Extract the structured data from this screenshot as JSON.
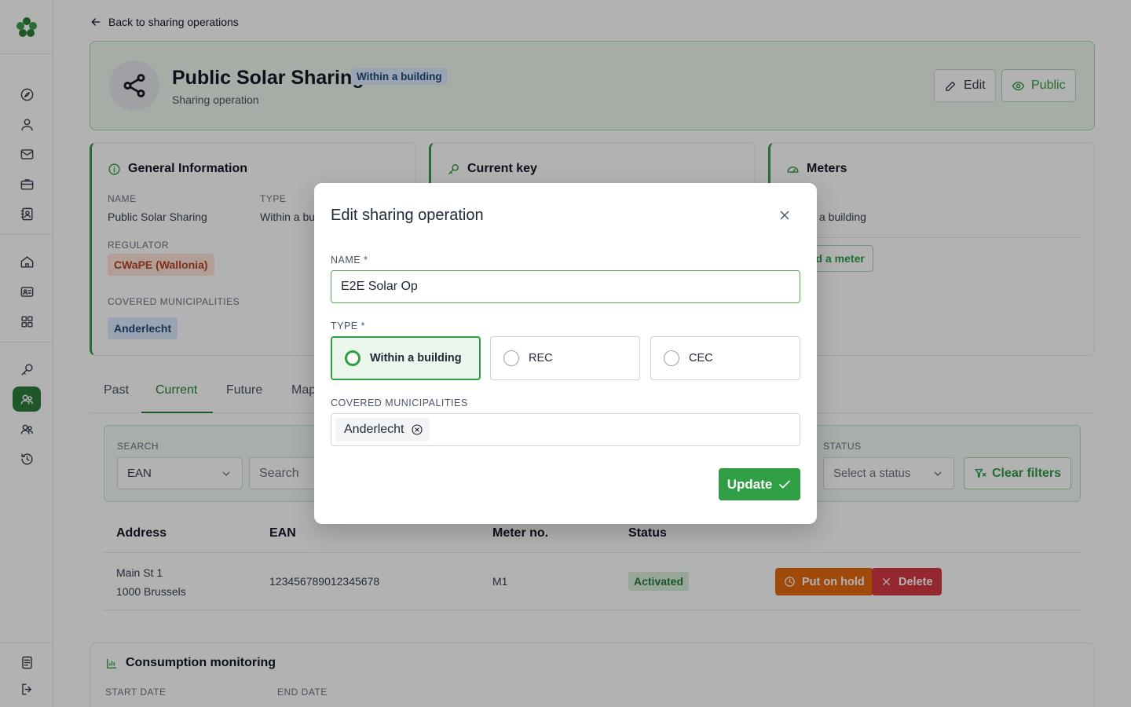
{
  "back_link": "Back to sharing operations",
  "header": {
    "title": "Public Solar Sharing",
    "badge": "Within a building",
    "subtitle": "Sharing operation",
    "edit_label": "Edit",
    "public_label": "Public"
  },
  "general_info": {
    "title": "General Information",
    "name_label": "NAME",
    "name_value": "Public Solar Sharing",
    "type_label": "TYPE",
    "type_value": "Within a bu",
    "regulator_label": "REGULATOR",
    "regulator_value": "CWaPE (Wallonia)",
    "municipalities_label": "COVERED MUNICIPALITIES",
    "municipality_chip": "Anderlecht"
  },
  "current_key": {
    "title": "Current key"
  },
  "meters": {
    "title": "Meters",
    "text": "a building",
    "add_label": "dd a meter"
  },
  "tabs": [
    "Past",
    "Current",
    "Future",
    "Map"
  ],
  "filters": {
    "search_label": "SEARCH",
    "search_type": "EAN",
    "search_placeholder": "Search",
    "status_label": "STATUS",
    "status_placeholder": "Select a status",
    "clear_label": "Clear filters"
  },
  "table": {
    "headers": [
      "Address",
      "EAN",
      "Meter no.",
      "Status"
    ],
    "rows": [
      {
        "address_line1": "Main St 1",
        "address_line2": "1000 Brussels",
        "ean": "123456789012345678",
        "meter": "M1",
        "status": "Activated",
        "hold_label": "Put on hold",
        "delete_label": "Delete"
      }
    ]
  },
  "consumption": {
    "title": "Consumption monitoring",
    "start_label": "START DATE",
    "end_label": "END DATE"
  },
  "modal": {
    "title": "Edit sharing operation",
    "name_label": "NAME *",
    "name_value": "E2E Solar Op",
    "type_label": "TYPE *",
    "type_options": [
      "Within a building",
      "REC",
      "CEC"
    ],
    "type_selected": "Within a building",
    "municipalities_label": "COVERED MUNICIPALITIES",
    "municipality_chip": "Anderlecht",
    "update_label": "Update"
  },
  "colors": {
    "primary_green": "#2f9e44",
    "active_sidebar": "#2f7d3a",
    "hold_orange": "#e46a11",
    "delete_red": "#d63a44"
  }
}
